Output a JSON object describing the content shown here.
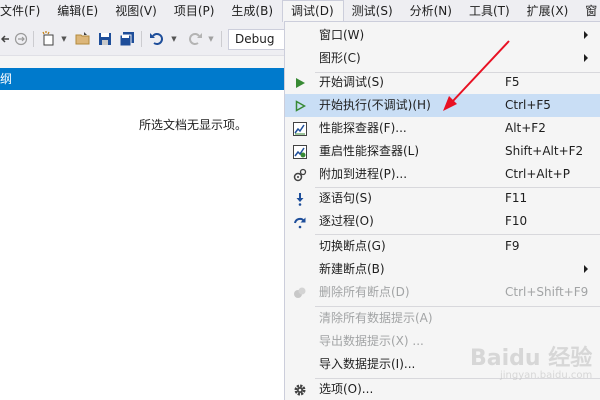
{
  "menubar": {
    "items": [
      {
        "label": "文件(F)"
      },
      {
        "label": "编辑(E)"
      },
      {
        "label": "视图(V)"
      },
      {
        "label": "项目(P)"
      },
      {
        "label": "生成(B)"
      },
      {
        "label": "调试(D)"
      },
      {
        "label": "测试(S)"
      },
      {
        "label": "分析(N)"
      },
      {
        "label": "工具(T)"
      },
      {
        "label": "扩展(X)"
      },
      {
        "label": "窗"
      }
    ],
    "active_index": 5
  },
  "toolbar": {
    "configuration": "Debug"
  },
  "panel": {
    "title": "纲",
    "empty_message": "所选文档无显示项。"
  },
  "debug_menu": {
    "items": [
      {
        "label": "窗口(W)",
        "shortcut": "",
        "icon": "none",
        "submenu": true
      },
      {
        "label": "图形(C)",
        "shortcut": "",
        "icon": "none",
        "submenu": true
      },
      {
        "label": "开始调试(S)",
        "shortcut": "F5",
        "icon": "play-filled-icon"
      },
      {
        "label": "开始执行(不调试)(H)",
        "shortcut": "Ctrl+F5",
        "icon": "play-outline-icon",
        "highlighted": true
      },
      {
        "label": "性能探查器(F)...",
        "shortcut": "Alt+F2",
        "icon": "performance-profiler-icon"
      },
      {
        "label": "重启性能探查器(L)",
        "shortcut": "Shift+Alt+F2",
        "icon": "restart-profiler-icon"
      },
      {
        "label": "附加到进程(P)...",
        "shortcut": "Ctrl+Alt+P",
        "icon": "attach-process-icon"
      },
      {
        "label": "逐语句(S)",
        "shortcut": "F11",
        "icon": "step-into-icon"
      },
      {
        "label": "逐过程(O)",
        "shortcut": "F10",
        "icon": "step-over-icon"
      },
      {
        "label": "切换断点(G)",
        "shortcut": "F9",
        "icon": "none"
      },
      {
        "label": "新建断点(B)",
        "shortcut": "",
        "icon": "none",
        "submenu": true
      },
      {
        "label": "删除所有断点(D)",
        "shortcut": "Ctrl+Shift+F9",
        "icon": "delete-breakpoints-icon",
        "disabled": true
      },
      {
        "label": "清除所有数据提示(A)",
        "shortcut": "",
        "icon": "none",
        "disabled": true
      },
      {
        "label": "导出数据提示(X) ...",
        "shortcut": "",
        "icon": "none",
        "disabled": true
      },
      {
        "label": "导入数据提示(I)...",
        "shortcut": "",
        "icon": "none"
      },
      {
        "label": "选项(O)...",
        "shortcut": "",
        "icon": "gear-icon"
      }
    ]
  },
  "watermark": {
    "logo": "Baidu 经验",
    "url": "jingyan.baidu.com"
  },
  "colors": {
    "accent": "#007acc",
    "highlight": "#c9def5",
    "arrow": "#e81123",
    "play_green": "#388a34"
  }
}
